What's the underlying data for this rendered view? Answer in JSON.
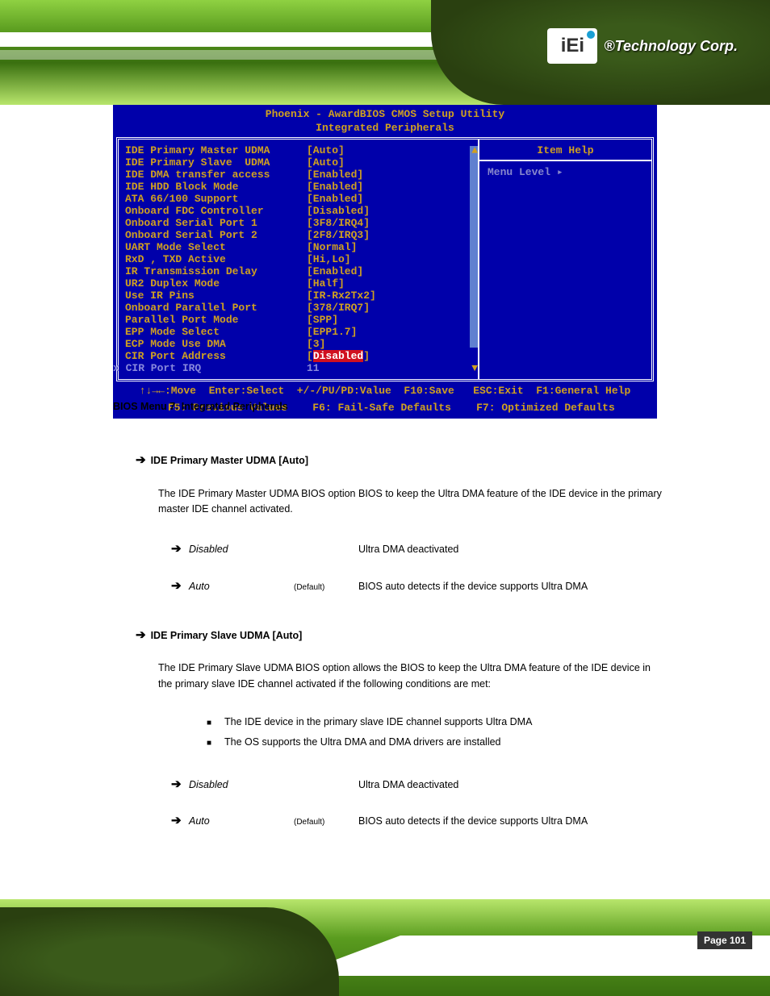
{
  "logo": {
    "brand": "iEi",
    "tagline": "®Technology Corp."
  },
  "bios": {
    "title1": "Phoenix - AwardBIOS CMOS Setup Utility",
    "title2": "Integrated Peripherals",
    "item_help_title": "Item Help",
    "menu_level": "Menu Level    ▸",
    "rows": [
      {
        "label": "IDE Primary Master UDMA",
        "value": "[Auto]"
      },
      {
        "label": "IDE Primary Slave  UDMA",
        "value": "[Auto]"
      },
      {
        "label": "IDE DMA transfer access",
        "value": "[Enabled]"
      },
      {
        "label": "IDE HDD Block Mode",
        "value": "[Enabled]"
      },
      {
        "label": "ATA 66/100 Support",
        "value": "[Enabled]"
      },
      {
        "label": "Onboard FDC Controller",
        "value": "[Disabled]"
      },
      {
        "label": "Onboard Serial Port 1",
        "value": "[3F8/IRQ4]"
      },
      {
        "label": "Onboard Serial Port 2",
        "value": "[2F8/IRQ3]"
      },
      {
        "label": "UART Mode Select",
        "value": "[Normal]"
      },
      {
        "label": "RxD , TXD Active",
        "value": "[Hi,Lo]"
      },
      {
        "label": "IR Transmission Delay",
        "value": "[Enabled]"
      },
      {
        "label": "UR2 Duplex Mode",
        "value": "[Half]"
      },
      {
        "label": "Use IR Pins",
        "value": "[IR-Rx2Tx2]"
      },
      {
        "label": "Onboard Parallel Port",
        "value": "[378/IRQ7]"
      },
      {
        "label": "Parallel Port Mode",
        "value": "[SPP]"
      },
      {
        "label": "EPP Mode Select",
        "value": "[EPP1.7]"
      },
      {
        "label": "ECP Mode Use DMA",
        "value": "[3]"
      }
    ],
    "highlight_row": {
      "label": "CIR Port Address",
      "value_pre": "[",
      "value_inner": "Disabled",
      "value_post": "]"
    },
    "disabled_row": {
      "label": "x CIR Port IRQ",
      "value": "11"
    },
    "footer1": "↑↓→←:Move  Enter:Select  +/-/PU/PD:Value  F10:Save   ESC:Exit  F1:General Help",
    "footer2": "  F5: Previous Values    F6: Fail-Safe Defaults    F7: Optimized Defaults"
  },
  "doc": {
    "figure_caption": "BIOS Menu 7: Integrated Peripherals",
    "section1": {
      "arrow": "➔",
      "title": "IDE Primary Master UDMA [Auto]",
      "body": "The IDE Primary Master UDMA BIOS option BIOS to keep the Ultra DMA feature of the IDE device in the primary master IDE channel activated.",
      "opt1": {
        "name": "Disabled",
        "desc": "Ultra DMA deactivated"
      },
      "opt2": {
        "name": "Auto",
        "tag": "(Default)",
        "desc": "BIOS auto detects if the device supports Ultra DMA"
      }
    },
    "section2": {
      "arrow": "➔",
      "title": "IDE Primary Slave UDMA [Auto]",
      "body": "The IDE Primary Slave UDMA BIOS option allows the BIOS to keep the Ultra DMA feature of the IDE device in the primary slave IDE channel activated if the following conditions are met:",
      "bullet1": "The IDE device in the primary slave IDE channel supports Ultra DMA",
      "bullet2": "The OS supports the Ultra DMA and DMA drivers are installed",
      "opt1": {
        "name": "Disabled",
        "desc": "Ultra DMA deactivated"
      },
      "opt2": {
        "name": "Auto",
        "tag": "(Default)",
        "desc": "BIOS auto detects if the device supports Ultra DMA"
      }
    },
    "page_label": "Page 101"
  }
}
